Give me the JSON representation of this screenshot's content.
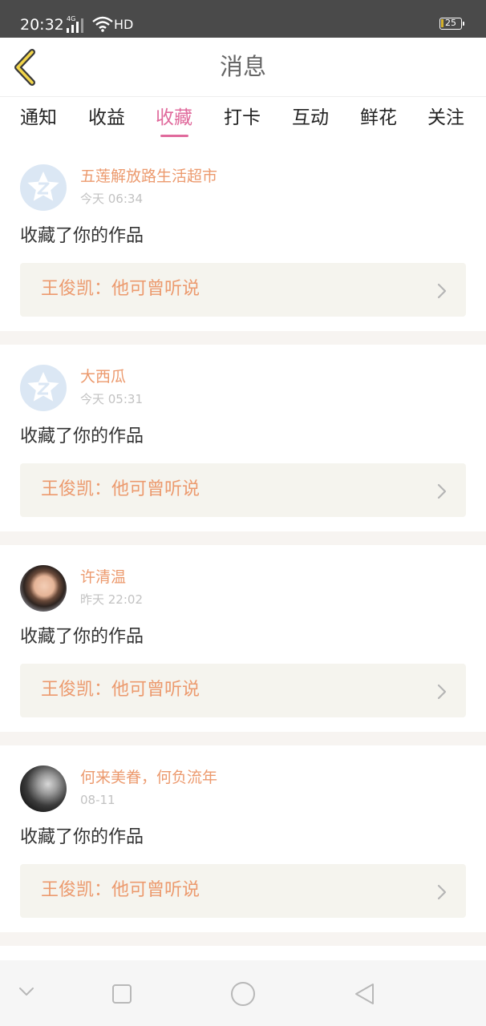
{
  "status_bar": {
    "time": "20:32",
    "network": "4G",
    "hd": "HD",
    "battery": "25"
  },
  "header": {
    "title": "消息",
    "back_icon": "chevron-left-icon"
  },
  "tabs": {
    "items": [
      "通知",
      "收益",
      "收藏",
      "打卡",
      "互动",
      "鲜花",
      "关注"
    ],
    "active_index": 2
  },
  "messages": [
    {
      "username": "五莲解放路生活超市",
      "time": "今天 06:34",
      "action": "收藏了你的作品",
      "work_title": "王俊凯：他可曾听说",
      "avatar": "default-avatar-icon"
    },
    {
      "username": "大西瓜",
      "time": "今天 05:31",
      "action": "收藏了你的作品",
      "work_title": "王俊凯：他可曾听说",
      "avatar": "default-avatar-icon"
    },
    {
      "username": "许清温",
      "time": "昨天 22:02",
      "action": "收藏了你的作品",
      "work_title": "王俊凯：他可曾听说",
      "avatar": "user-photo"
    },
    {
      "username": "何来美眷，何负流年",
      "time": "08-11",
      "action": "收藏了你的作品",
      "work_title": "王俊凯：他可曾听说",
      "avatar": "user-photo"
    }
  ],
  "colors": {
    "accent": "#e06a9c",
    "username": "#ec9a6e",
    "status_bar": "#4a4a4a",
    "work_box": "#f5f4ee"
  },
  "nav_bar": {
    "icons": [
      "chevron-down-icon",
      "square-recents-icon",
      "circle-home-icon",
      "triangle-back-icon"
    ]
  }
}
